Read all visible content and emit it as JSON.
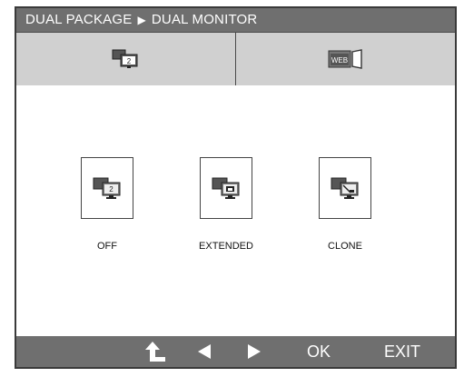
{
  "header": {
    "crumb_parent": "DUAL PACKAGE",
    "separator": "▶",
    "crumb_current": "DUAL MONITOR"
  },
  "tabs": [
    {
      "name": "dual-monitor",
      "icon": "dual-monitor-icon",
      "badge": "2"
    },
    {
      "name": "dual-web",
      "icon": "dual-web-icon",
      "badge": "WEB"
    }
  ],
  "options": [
    {
      "label": "OFF",
      "icon": "monitor-2-icon",
      "badge": "2"
    },
    {
      "label": "EXTENDED",
      "icon": "monitor-extended-icon"
    },
    {
      "label": "CLONE",
      "icon": "monitor-clone-icon"
    }
  ],
  "footer": {
    "up_icon": "up-arrow-icon",
    "left_icon": "left-arrow-icon",
    "right_icon": "right-arrow-icon",
    "ok_label": "OK",
    "exit_label": "EXIT"
  },
  "colors": {
    "frame": "#6f6f6f",
    "tab_background": "#d0d0d0",
    "content_background": "#ffffff",
    "text_light": "#ffffff"
  }
}
